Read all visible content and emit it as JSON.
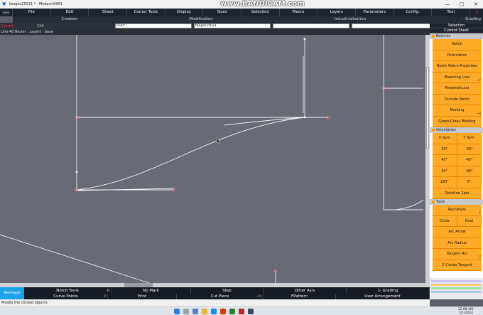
{
  "titlebar": {
    "title": "tbogos25031 * - ModarisV8R1",
    "minimize": "—",
    "maximize": "□",
    "close": "✕"
  },
  "watermark": {
    "text": "www.BANDICAM.com"
  },
  "menubar": {
    "logo": "www",
    "items": [
      "File",
      "Edit",
      "Sheet",
      "Corner Tools",
      "Display",
      "Sizes",
      "Selection",
      "Macro",
      "Layers",
      "Parameters",
      "Config.",
      "Tool"
    ],
    "help_icon": "?"
  },
  "subbar": {
    "creation": "Creation",
    "modification": "Modification",
    "industrialization": "Industrialization",
    "grading": "Grading"
  },
  "fieldbar": {
    "label": "Sysdef",
    "value": "114",
    "field1": "0.00°",
    "field2": "tbogos25031",
    "field3": "",
    "field4": ""
  },
  "statusline": {
    "text": "Line 40  Bezier ;     Layers : base"
  },
  "right_panel": {
    "selection_label": "Selection",
    "sheet_label": "Current Sheet",
    "notches_title": "Notches",
    "notches_buttons": [
      {
        "label": "Notch",
        "hotkey": ""
      },
      {
        "label": "Orientation",
        "hotkey": ""
      },
      {
        "label": "Notch Notch Projection",
        "hotkey": ""
      },
      {
        "label": "Bisecting Line",
        "hotkey": "~Y"
      },
      {
        "label": "Perpendicular",
        "hotkey": ""
      },
      {
        "label": "Outside Notch",
        "hotkey": ""
      },
      {
        "label": "Marking",
        "hotkey": "~8"
      },
      {
        "label": "Green/Cross Marking",
        "hotkey": ""
      }
    ],
    "orientation_title": "Orientation",
    "orientation_rows": [
      [
        "X Sym",
        "Y Sym"
      ],
      [
        "30°",
        "-30°"
      ],
      [
        "45°",
        "-45°"
      ],
      [
        "90°",
        "-90°"
      ],
      [
        "180°",
        "0°"
      ]
    ],
    "rotation_button": "Rotation 2pts",
    "tools_title": "Tools",
    "tools_buttons": [
      {
        "label": "Rectangle",
        "hotkey": "F"
      },
      {
        "label": "Arc Arrow",
        "hotkey": ""
      },
      {
        "label": "Arc Radius",
        "hotkey": ""
      },
      {
        "label": "Tangent Arc",
        "hotkey": "7"
      },
      {
        "label": "2 Circles Tangent",
        "hotkey": ""
      }
    ],
    "tools_row": [
      "Circle",
      "Oval"
    ]
  },
  "bottombar": {
    "reshape": "Reshape",
    "row1": [
      {
        "label": "Notch Tools",
        "hotkey": "M"
      },
      {
        "label": "No Mark",
        "hotkey": ""
      },
      {
        "label": "Step",
        "hotkey": ""
      },
      {
        "label": "Other Axis",
        "hotkey": ""
      },
      {
        "label": "1- Grading",
        "hotkey": ""
      }
    ],
    "row2": [
      {
        "label": "Curve Points",
        "hotkey": "P"
      },
      {
        "label": "Print",
        "hotkey": ""
      },
      {
        "label": "Cut Piece",
        "hotkey": "~F9"
      },
      {
        "label": "FPattern",
        "hotkey": ""
      },
      {
        "label": "User Arrangement",
        "hotkey": ""
      }
    ]
  },
  "infobar": {
    "text": "Modify the clicked objects"
  },
  "taskbar": {
    "time": "12:08 AM",
    "date": "1/1/2024"
  }
}
